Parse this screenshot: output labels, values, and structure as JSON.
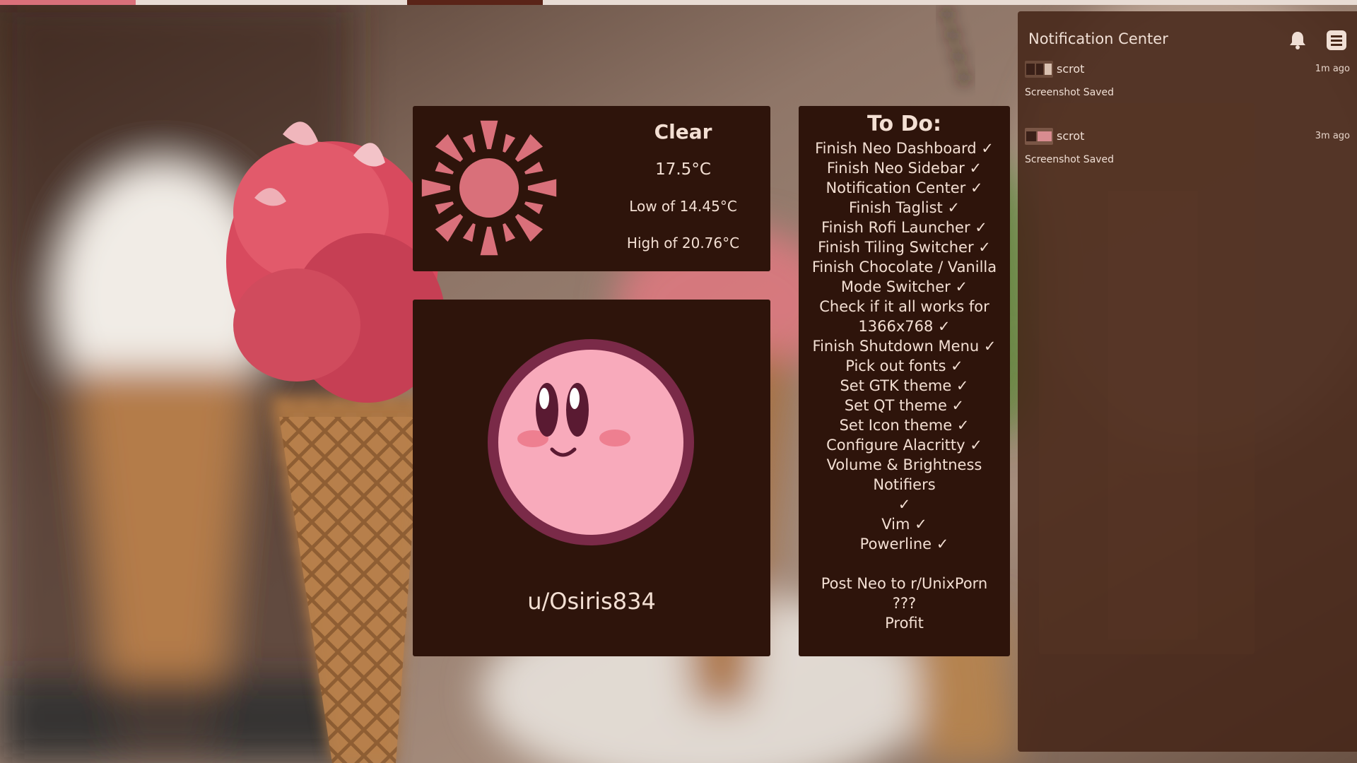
{
  "tagbar": {
    "colors": [
      "#d9707a",
      "#e8dcd4",
      "#e8dcd4",
      "#5a2418",
      "#e8dcd4",
      "#e8dcd4",
      "#e8dcd4",
      "#e8dcd4",
      "#e8dcd4",
      "#e8dcd4"
    ],
    "active_index": 3
  },
  "weather": {
    "icon": "sun-icon",
    "condition": "Clear",
    "temperature": "17.5°C",
    "low": "Low of 14.45°C",
    "high": "High of 20.76°C",
    "icon_color": "#d9707a"
  },
  "profile": {
    "avatar": "kirby-avatar",
    "username": "u/Osiris834"
  },
  "todo": {
    "title": "To Do:",
    "items": [
      "Finish Neo Dashboard ✓",
      "Finish Neo Sidebar ✓",
      "Notification Center ✓",
      "Finish Taglist ✓",
      "Finish Rofi Launcher ✓",
      "Finish Tiling Switcher ✓",
      "Finish Chocolate / Vanilla",
      "Mode Switcher ✓",
      "Check if it all works for",
      "1366x768 ✓",
      "Finish Shutdown Menu ✓",
      "Pick out fonts ✓",
      "Set GTK theme ✓",
      "Set QT theme ✓",
      "Set Icon theme ✓",
      "Configure Alacritty ✓",
      "Volume & Brightness Notifiers",
      "✓",
      "Vim ✓",
      "Powerline ✓"
    ],
    "extras": [
      "Post Neo to r/UnixPorn",
      "???",
      "Profit"
    ]
  },
  "notification_center": {
    "title": "Notification Center",
    "bell_icon": "bell-icon",
    "menu_icon": "menu-icon",
    "notifications": [
      {
        "app": "scrot",
        "time": "1m ago",
        "body": "Screenshot Saved"
      },
      {
        "app": "scrot",
        "time": "3m ago",
        "body": "Screenshot Saved"
      }
    ]
  },
  "colors": {
    "widget_bg": "#2e140b",
    "widget_text": "#f3dfd3",
    "accent": "#d9707a",
    "panel_bg": "#462618"
  }
}
